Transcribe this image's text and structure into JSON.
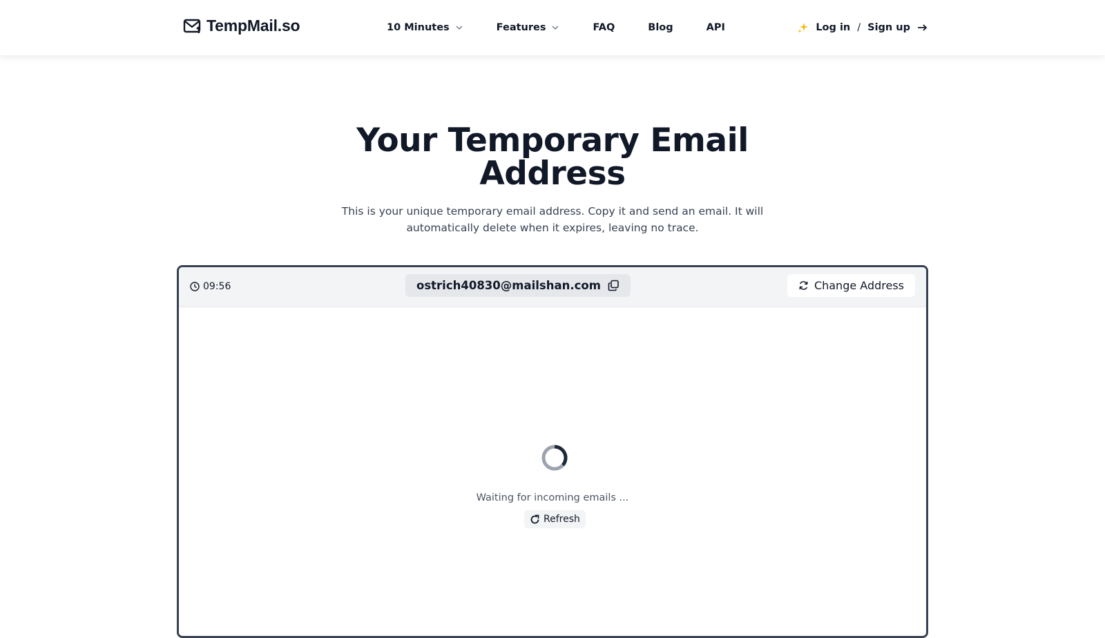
{
  "brand": {
    "name": "TempMail.so",
    "icon": "mail-icon"
  },
  "nav": {
    "items": [
      {
        "label": "10 Minutes",
        "has_dropdown": true
      },
      {
        "label": "Features",
        "has_dropdown": true
      },
      {
        "label": "FAQ",
        "has_dropdown": false
      },
      {
        "label": "Blog",
        "has_dropdown": false
      },
      {
        "label": "API",
        "has_dropdown": false
      }
    ]
  },
  "auth": {
    "login_label": "Log in",
    "separator": "/",
    "signup_label": "Sign up",
    "icon": "sparkle-icon",
    "accent_color": "#f5b700"
  },
  "hero": {
    "title": "Your Temporary Email Address",
    "description": "This is your unique temporary email address. Copy it and send an email. It will automatically delete when it expires, leaving no trace."
  },
  "inbox": {
    "timer": "09:56",
    "email_address": "ostrich40830@mailshan.com",
    "change_label": "Change Address",
    "waiting_text": "Waiting for incoming emails ...",
    "refresh_label": "Refresh"
  }
}
